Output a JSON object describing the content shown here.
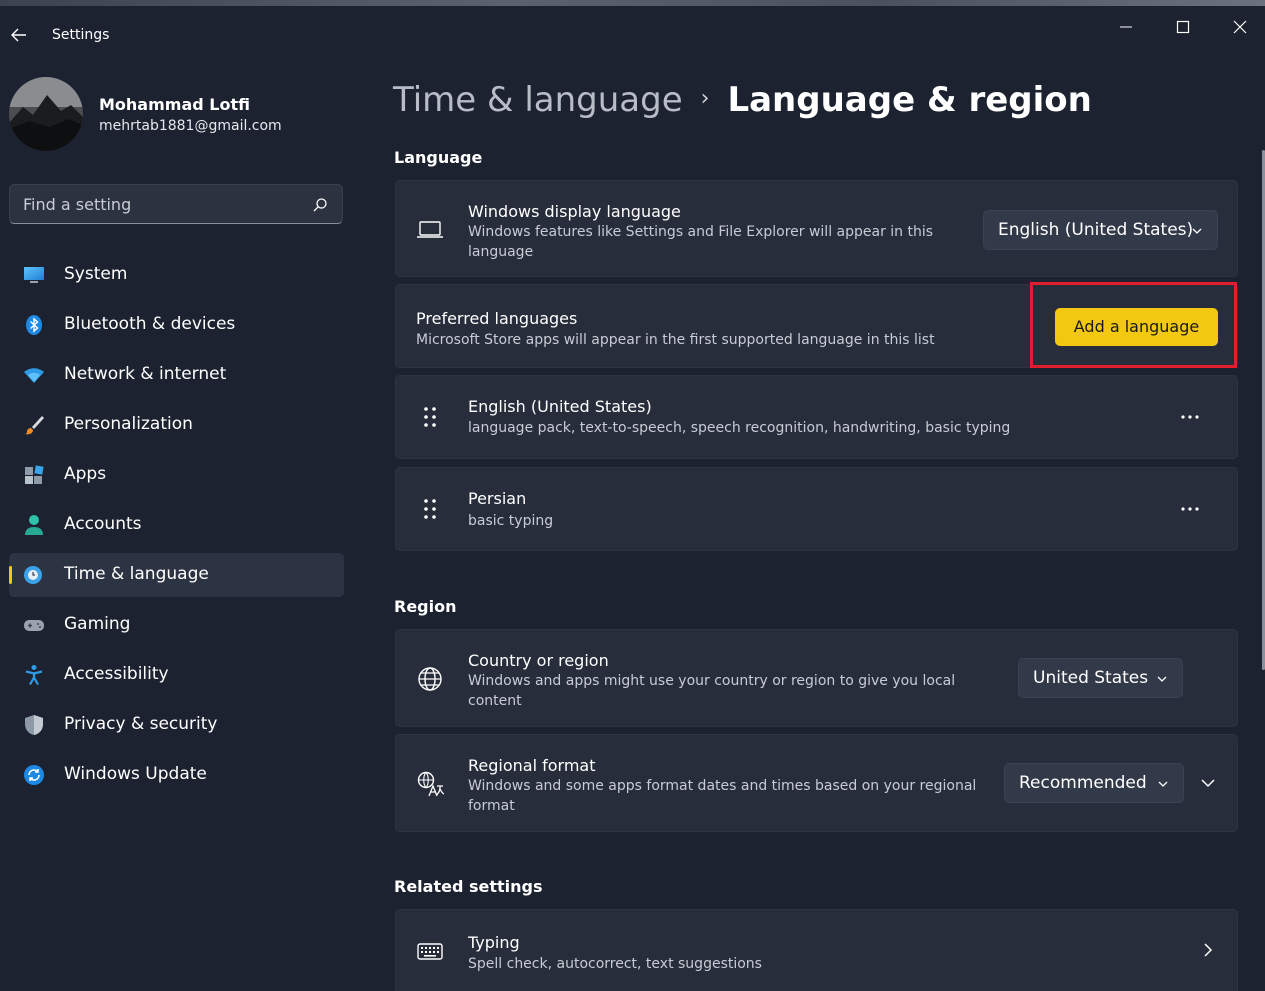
{
  "window": {
    "title": "Settings"
  },
  "profile": {
    "name": "Mohammad Lotfi",
    "email": "mehrtab1881@gmail.com"
  },
  "search": {
    "placeholder": "Find a setting"
  },
  "nav": {
    "items": [
      {
        "label": "System",
        "icon": "monitor-icon"
      },
      {
        "label": "Bluetooth & devices",
        "icon": "bluetooth-icon"
      },
      {
        "label": "Network & internet",
        "icon": "wifi-icon"
      },
      {
        "label": "Personalization",
        "icon": "brush-icon"
      },
      {
        "label": "Apps",
        "icon": "apps-icon"
      },
      {
        "label": "Accounts",
        "icon": "person-icon"
      },
      {
        "label": "Time & language",
        "icon": "globe-clock-icon",
        "active": true
      },
      {
        "label": "Gaming",
        "icon": "gamepad-icon"
      },
      {
        "label": "Accessibility",
        "icon": "accessibility-icon"
      },
      {
        "label": "Privacy & security",
        "icon": "shield-icon"
      },
      {
        "label": "Windows Update",
        "icon": "update-icon"
      }
    ]
  },
  "breadcrumb": {
    "parent": "Time & language",
    "separator": "›",
    "current": "Language & region"
  },
  "language": {
    "heading": "Language",
    "display": {
      "title": "Windows display language",
      "desc": "Windows features like Settings and File Explorer will appear in this language",
      "value": "English (United States)"
    },
    "preferred": {
      "title": "Preferred languages",
      "desc": "Microsoft Store apps will appear in the first supported language in this list",
      "button": "Add a language"
    },
    "list": [
      {
        "name": "English (United States)",
        "features": "language pack, text-to-speech, speech recognition, handwriting, basic typing"
      },
      {
        "name": "Persian",
        "features": "basic typing"
      }
    ]
  },
  "region": {
    "heading": "Region",
    "country": {
      "title": "Country or region",
      "desc": "Windows and apps might use your country or region to give you local content",
      "value": "United States"
    },
    "format": {
      "title": "Regional format",
      "desc": "Windows and some apps format dates and times based on your regional format",
      "value": "Recommended"
    }
  },
  "related": {
    "heading": "Related settings",
    "typing": {
      "title": "Typing",
      "desc": "Spell check, autocorrect, text suggestions"
    }
  },
  "colors": {
    "accent": "#f2c811",
    "highlight": "#e01e2e",
    "background": "#1c2230",
    "card": "#272d3b"
  }
}
